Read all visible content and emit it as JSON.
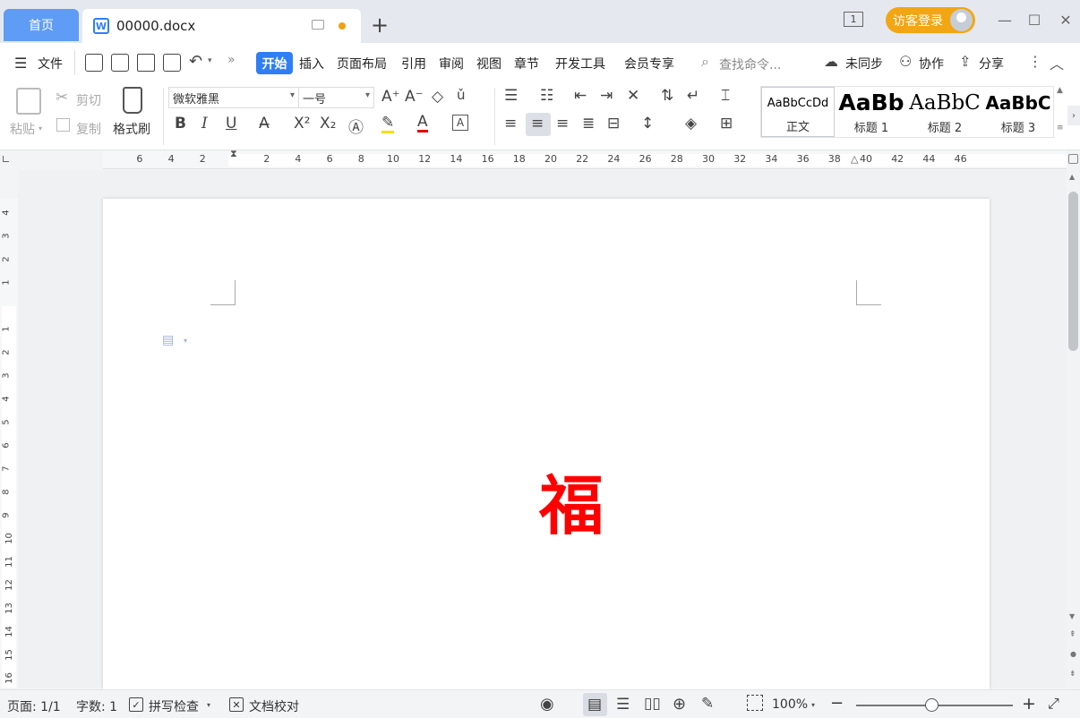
{
  "titlebar": {
    "home_tab": "首页",
    "doc_tab": "00000.docx",
    "page_count": "1",
    "login_label": "访客登录"
  },
  "menu": {
    "file_label": "文件",
    "tabs": [
      "开始",
      "插入",
      "页面布局",
      "引用",
      "审阅",
      "视图",
      "章节",
      "开发工具",
      "会员专享"
    ],
    "search_placeholder": "查找命令...",
    "sync_label": "未同步",
    "collab_label": "协作",
    "share_label": "分享"
  },
  "ribbon": {
    "paste_label": "粘贴",
    "cut_label": "剪切",
    "copy_label": "复制",
    "format_painter_label": "格式刷",
    "font_name": "微软雅黑",
    "font_size": "一号",
    "styles": [
      {
        "preview": "AaBbCcDd",
        "label": "正文"
      },
      {
        "preview": "AaBb",
        "label": "标题 1"
      },
      {
        "preview": "AaBbC",
        "label": "标题 2"
      },
      {
        "preview": "AaBbC",
        "label": "标题 3"
      }
    ]
  },
  "ruler": {
    "h_left": [
      "6",
      "4",
      "2"
    ],
    "h_right": [
      "2",
      "4",
      "6",
      "8",
      "10",
      "12",
      "14",
      "16",
      "18",
      "20",
      "22",
      "24",
      "26",
      "28",
      "30",
      "32",
      "34",
      "36",
      "38",
      "40",
      "42",
      "44",
      "46"
    ],
    "v_top": [
      "4",
      "3",
      "2",
      "1"
    ],
    "v_main": [
      "1",
      "2",
      "3",
      "4",
      "5",
      "6",
      "7",
      "8",
      "9",
      "10",
      "11",
      "12",
      "13",
      "14",
      "15",
      "16"
    ]
  },
  "document": {
    "content": "福",
    "content_color": "#ff0000"
  },
  "status": {
    "page": "页面: 1/1",
    "words": "字数: 1",
    "spell_check": "拼写检查",
    "proofread": "文档校对",
    "zoom": "100%"
  },
  "colors": {
    "accent": "#2f7ef5",
    "login": "#f3a614",
    "home_tab": "#5f9cf5"
  }
}
